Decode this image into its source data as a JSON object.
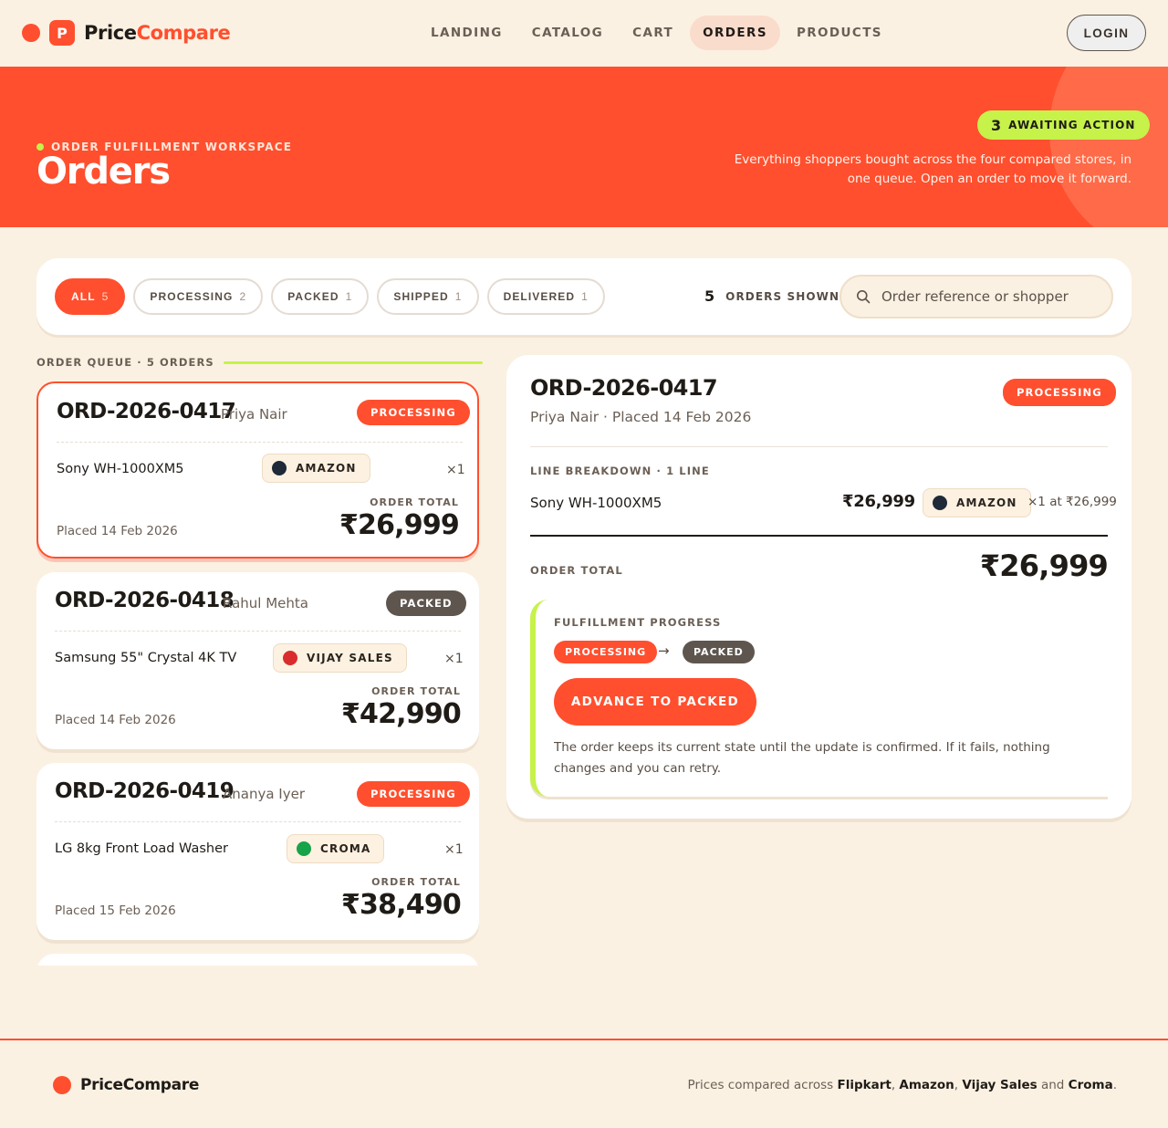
{
  "brand": {
    "name_a": "Price",
    "name_b": "Compare",
    "logo_letter": "P",
    "accent": "#ff4f2e"
  },
  "nav": {
    "links": [
      "LANDING",
      "CATALOG",
      "CART",
      "ORDERS",
      "PRODUCTS"
    ],
    "active": "ORDERS",
    "login": "LOGIN"
  },
  "hero": {
    "eyebrow": "ORDER FULFILLMENT WORKSPACE",
    "title": "Orders",
    "awaiting_count": "3",
    "awaiting_label": "AWAITING ACTION",
    "description": "Everything shoppers bought across the four compared stores, in one queue. Open an order to move it forward."
  },
  "filters": {
    "chips": [
      {
        "label": "ALL",
        "count": "5"
      },
      {
        "label": "PROCESSING",
        "count": "2"
      },
      {
        "label": "PACKED",
        "count": "1"
      },
      {
        "label": "SHIPPED",
        "count": "1"
      },
      {
        "label": "DELIVERED",
        "count": "1"
      }
    ],
    "shown_count": "5",
    "shown_label": "ORDERS SHOWN",
    "search_placeholder": "Order reference or shopper"
  },
  "queue": {
    "heading": "ORDER QUEUE · 5 ORDERS",
    "total_label": "ORDER TOTAL",
    "orders": [
      {
        "id": "ORD-2026-0417",
        "shopper": "Priya Nair",
        "status": "PROCESSING",
        "product": "Sony WH-1000XM5",
        "store": "AMAZON",
        "store_color": "#1f2937",
        "qty": "×1",
        "date": "Placed 14 Feb 2026",
        "total": "₹26,999"
      },
      {
        "id": "ORD-2026-0418",
        "shopper": "Rahul Mehta",
        "status": "PACKED",
        "product": "Samsung 55\" Crystal 4K TV",
        "store": "VIJAY SALES",
        "store_color": "#d92d2d",
        "qty": "×1",
        "date": "Placed 14 Feb 2026",
        "total": "₹42,990"
      },
      {
        "id": "ORD-2026-0419",
        "shopper": "Ananya Iyer",
        "status": "PROCESSING",
        "product": "LG 8kg Front Load Washer",
        "store": "CROMA",
        "store_color": "#16a34a",
        "qty": "×1",
        "date": "Placed 15 Feb 2026",
        "total": "₹38,490"
      }
    ]
  },
  "detail": {
    "id": "ORD-2026-0417",
    "status": "PROCESSING",
    "subtitle": "Priya Nair · Placed 14 Feb 2026",
    "breakdown_label": "LINE BREAKDOWN · 1 LINE",
    "line": {
      "product": "Sony WH-1000XM5",
      "price": "₹26,999",
      "store": "AMAZON",
      "store_color": "#1f2937",
      "qty_text": "×1 at ₹26,999"
    },
    "total_label": "ORDER TOTAL",
    "total": "₹26,999",
    "progress": {
      "label": "FULFILLMENT PROGRESS",
      "from": "PROCESSING",
      "arrow": "→",
      "to": "PACKED",
      "button": "ADVANCE TO PACKED",
      "note": "The order keeps its current state until the update is confirmed. If it fails, nothing changes and you can retry."
    }
  },
  "footer": {
    "brand": "PriceCompare",
    "text_prefix": "Prices compared across ",
    "stores": [
      "Flipkart",
      "Amazon",
      "Vijay Sales",
      "Croma"
    ],
    "sep1": ", ",
    "sep2": " and ",
    "suffix": "."
  }
}
